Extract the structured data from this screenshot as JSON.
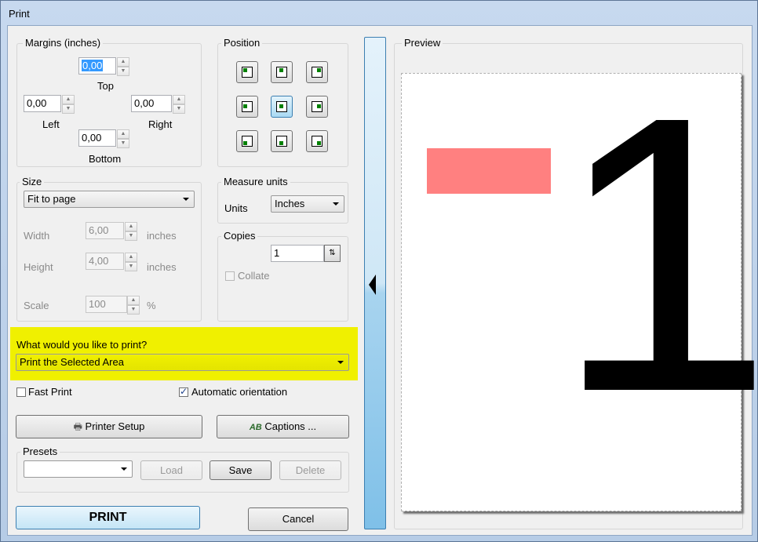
{
  "window": {
    "title": "Print"
  },
  "margins": {
    "label": "Margins (inches)",
    "top": {
      "label": "Top",
      "value": "0,00"
    },
    "left": {
      "label": "Left",
      "value": "0,00"
    },
    "right": {
      "label": "Right",
      "value": "0,00"
    },
    "bottom": {
      "label": "Bottom",
      "value": "0,00"
    }
  },
  "position": {
    "label": "Position",
    "selected": "center"
  },
  "size": {
    "label": "Size",
    "mode": "Fit to page",
    "width": {
      "label": "Width",
      "value": "6,00",
      "unit": "inches"
    },
    "height": {
      "label": "Height",
      "value": "4,00",
      "unit": "inches"
    },
    "scale": {
      "label": "Scale",
      "value": "100",
      "unit": "%"
    }
  },
  "measure": {
    "label": "Measure units",
    "units_label": "Units",
    "value": "Inches"
  },
  "copies": {
    "label": "Copies",
    "value": "1",
    "collate": "Collate"
  },
  "print_what": {
    "question": "What would you like to print?",
    "value": "Print the Selected Area",
    "highlight": "#f0f000"
  },
  "options": {
    "fast_print": "Fast Print",
    "fast_print_checked": false,
    "auto_orientation": "Automatic orientation",
    "auto_orientation_checked": true
  },
  "buttons": {
    "printer_setup": "Printer Setup",
    "captions": "Captions ...",
    "print": "PRINT",
    "cancel": "Cancel"
  },
  "presets": {
    "label": "Presets",
    "value": "",
    "load": "Load",
    "save": "Save",
    "delete": "Delete"
  },
  "preview": {
    "label": "Preview",
    "glyph": "1",
    "swatch_color": "#ff8080"
  }
}
